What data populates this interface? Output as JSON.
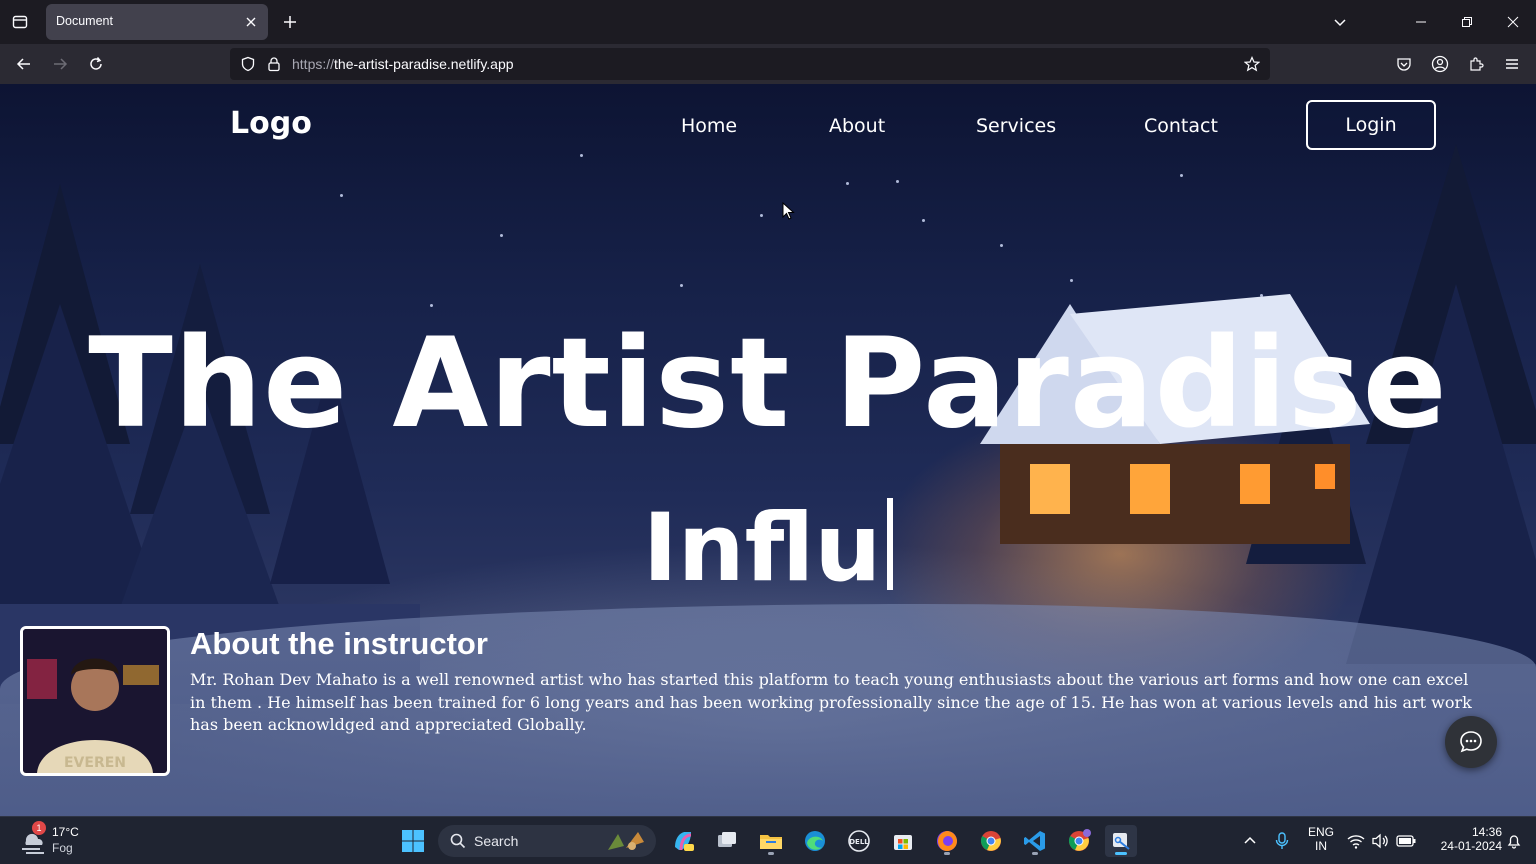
{
  "browser": {
    "tab_title": "Document",
    "url_scheme": "https://",
    "url_host": "the-artist-paradise.netlify.app"
  },
  "site": {
    "logo": "Logo",
    "nav": [
      "Home",
      "About",
      "Services",
      "Contact"
    ],
    "login": "Login",
    "hero_title": "The Artist Paradise",
    "hero_typed": "Influ",
    "about_title": "About the instructor",
    "about_text": "Mr. Rohan Dev Mahato is a well renowned artist who has started this platform to teach young enthusiasts about the various art forms and how one can excel in them . He himself has been trained for 6 long years and has been working professionally since the age of 15. He has won at various levels and his art work has been acknowldged and appreciated Globally.",
    "photo_shirt_text": "EVEREN"
  },
  "taskbar": {
    "weather_temp": "17°C",
    "weather_cond": "Fog",
    "weather_badge": "1",
    "search": "Search",
    "lang_line1": "ENG",
    "lang_line2": "IN",
    "time": "14:36",
    "date": "24-01-2024"
  },
  "colors": {
    "chrome_dark": "#1c1b22",
    "chrome_toolbar": "#2b2a33",
    "taskbar": "#1f2431",
    "accent_white": "#ffffff"
  },
  "icons": [
    "tab-list-icon",
    "close-icon",
    "plus-icon",
    "chevron-down-icon",
    "minimize-icon",
    "restore-icon",
    "back-icon",
    "forward-icon",
    "reload-icon",
    "shield-icon",
    "lock-icon",
    "star-icon",
    "pocket-icon",
    "account-icon",
    "extensions-icon",
    "menu-icon",
    "chat-icon",
    "windows-start-icon",
    "search-icon"
  ]
}
